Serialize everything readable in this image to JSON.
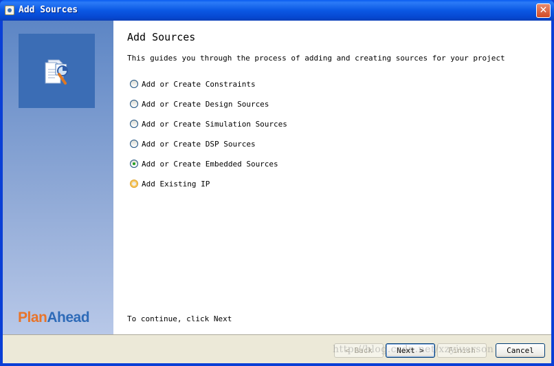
{
  "window": {
    "title": "Add Sources",
    "close_symbol": "✕"
  },
  "sidebar": {
    "brand_part1": "Plan",
    "brand_part2": "Ahead"
  },
  "content": {
    "heading": "Add Sources",
    "description": "This guides you through the process of adding and creating sources for your project",
    "options": [
      {
        "label": "Add or Create Constraints",
        "checked": false
      },
      {
        "label": "Add or Create Design Sources",
        "checked": false
      },
      {
        "label": "Add or Create Simulation Sources",
        "checked": false
      },
      {
        "label": "Add or Create DSP Sources",
        "checked": false
      },
      {
        "label": "Add or Create Embedded Sources",
        "checked": true
      },
      {
        "label": "Add Existing IP",
        "checked": false
      }
    ],
    "footer_text": "To continue, click Next"
  },
  "buttons": {
    "back": "< Back",
    "next": "Next >",
    "finish": "Finish",
    "cancel": "Cancel"
  },
  "watermark": "http://blog.csdn.net/xzyiverson",
  "colors": {
    "title_bar": "#0a5df0",
    "side_panel": "#5d86c5",
    "brand_orange": "#e8742a",
    "brand_blue": "#2e6bb8",
    "radio_checked": "#21a121"
  }
}
